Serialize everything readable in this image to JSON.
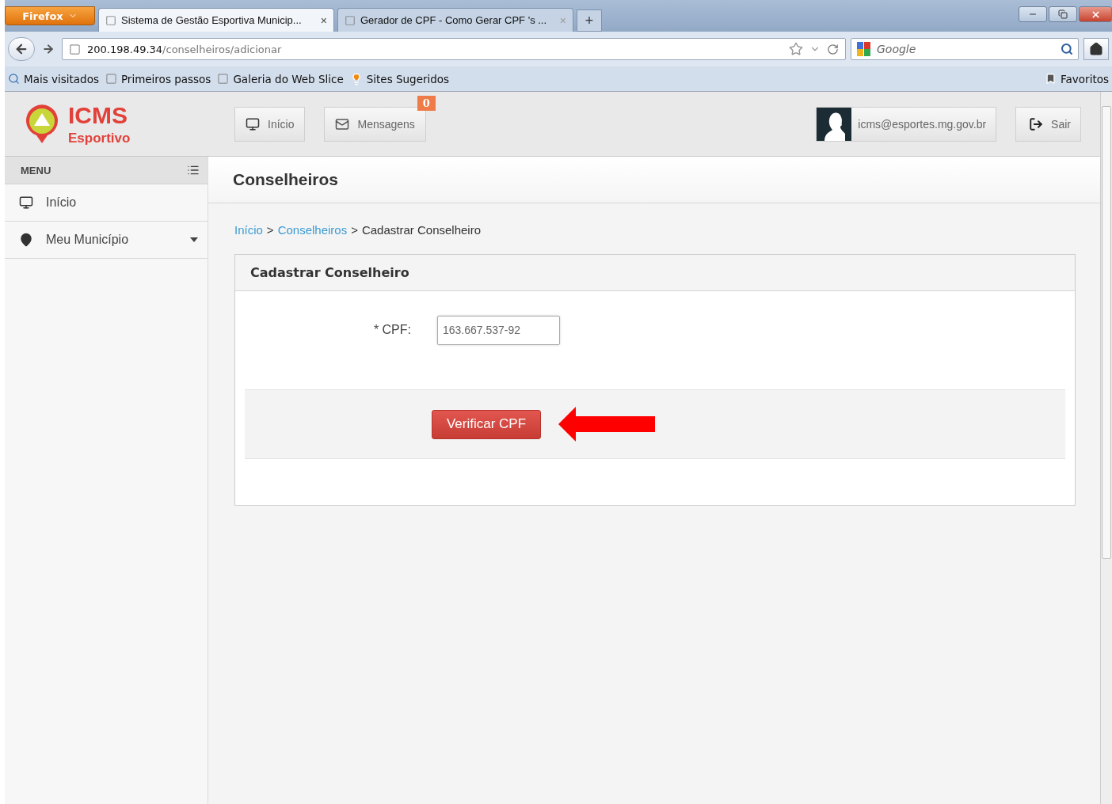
{
  "browser": {
    "menu_button": "Firefox",
    "tabs": [
      {
        "title": "Sistema de Gestão Esportiva Municip...",
        "close": "×",
        "selected": true
      },
      {
        "title": "Gerador de CPF - Como Gerar CPF 's ...",
        "close": "×",
        "selected": false
      }
    ],
    "new_tab": "+",
    "url": {
      "host": "200.198.49.34",
      "path": "/conselheiros/adicionar"
    },
    "search": {
      "placeholder": "Google"
    },
    "bookmarks": [
      {
        "label": "Mais visitados",
        "kind": "search"
      },
      {
        "label": "Primeiros passos",
        "kind": "page"
      },
      {
        "label": "Galeria do Web Slice",
        "kind": "page"
      },
      {
        "label": "Sites Sugeridos",
        "kind": "suggest"
      }
    ],
    "favorites": "Favoritos"
  },
  "header": {
    "logo": {
      "title": "ICMS",
      "subtitle": "Esportivo"
    },
    "nav_buttons": [
      {
        "label": "Início",
        "kind": "home"
      },
      {
        "label": "Mensagens",
        "kind": "mail",
        "badge": "0"
      }
    ],
    "user": {
      "email": "icms@esportes.mg.gov.br"
    },
    "logout": "Sair"
  },
  "sidebar": {
    "title": "MENU",
    "items": [
      {
        "label": "Início",
        "kind": "home",
        "has_submenu": false
      },
      {
        "label": "Meu Município",
        "kind": "pin",
        "has_submenu": true
      }
    ]
  },
  "main": {
    "title": "Conselheiros",
    "breadcrumb": [
      {
        "label": "Início",
        "kind": "link"
      },
      {
        "label": ">",
        "kind": "separator"
      },
      {
        "label": "Conselheiros",
        "kind": "link"
      },
      {
        "label": ">",
        "kind": "separator"
      },
      {
        "label": "Cadastrar Conselheiro",
        "kind": "current"
      }
    ],
    "form": {
      "title": "Cadastrar Conselheiro",
      "field": {
        "label": "* CPF:",
        "value": "163.667.537-92"
      },
      "submit": "Verificar CPF"
    }
  }
}
